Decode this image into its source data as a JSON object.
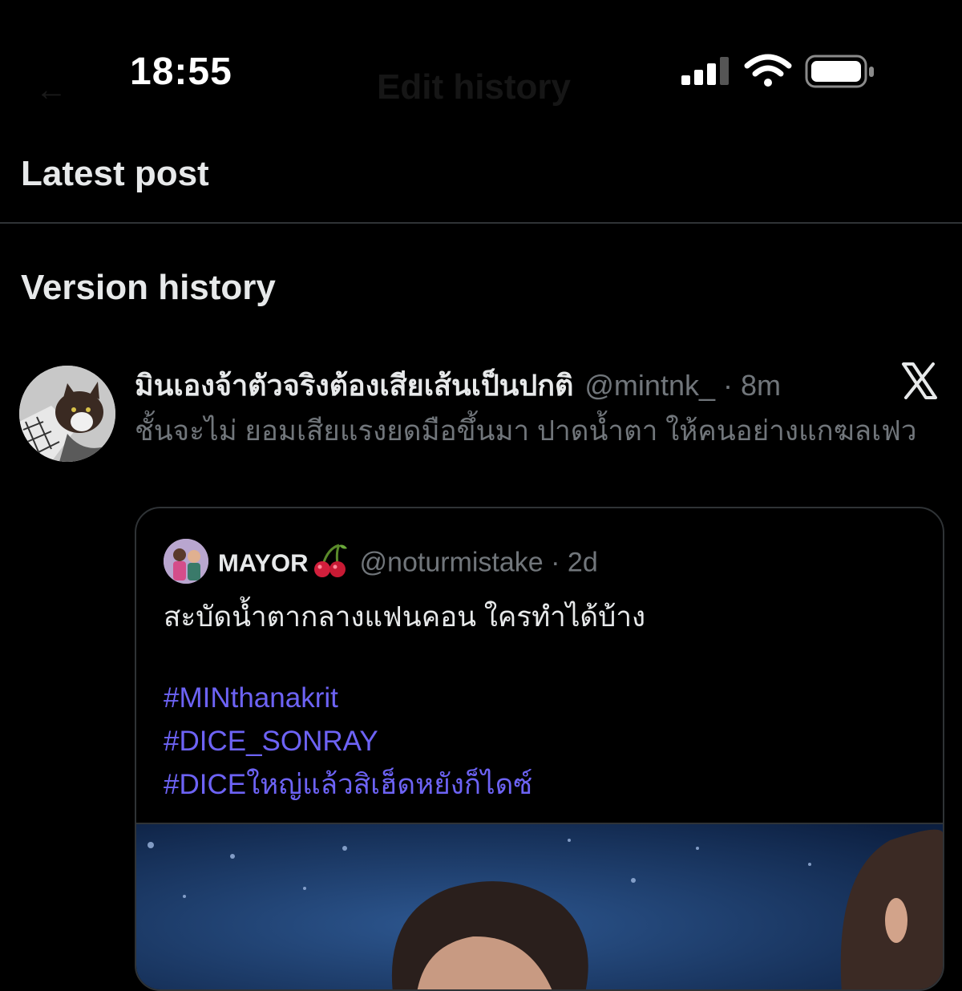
{
  "status_bar": {
    "time": "18:55"
  },
  "nav": {
    "back_glyph": "←",
    "title": "Edit history"
  },
  "sections": {
    "latest": "Latest post",
    "version": "Version history"
  },
  "post": {
    "display_name": "มินเองจ้าตัวจริงต้องเสียเส้นเป็นปกติ",
    "handle_meta": "@mintnk_ · 8m",
    "text": "ชั้นจะไม่ ยอมเสียแรงยดมือขึ้นมา ปาดน้ำตา ให้คนอย่างแกฆลเฟว",
    "source_icon": "x-logo-icon"
  },
  "quote": {
    "display_name": "MAYOR",
    "emoji": "cherries-icon",
    "handle_meta": "@noturmistake · 2d",
    "text": "สะบัดน้ำตากลางแฟนคอน ใครทำได้บ้าง",
    "hashtags": [
      "#MINthanakrit",
      "#DICE_SONRAY",
      "#DICEใหญ่แล้วสิเฮ็ดหยังก็ไดซ์"
    ]
  },
  "colors": {
    "background": "#000000",
    "text": "#e7e9ea",
    "muted": "#71767b",
    "hashtag": "#6d63f5",
    "border": "#2f3336"
  }
}
